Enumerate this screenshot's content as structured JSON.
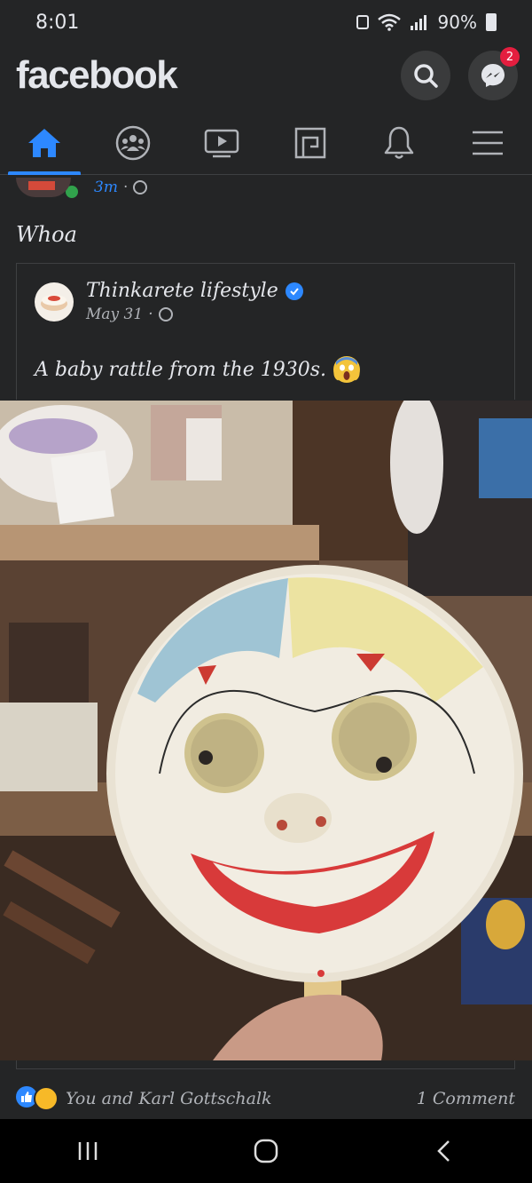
{
  "status_bar": {
    "time": "8:01",
    "battery": "90%"
  },
  "header": {
    "logo": "facebook",
    "messenger_badge": "2"
  },
  "nav": {
    "tabs": [
      "home-icon",
      "groups-icon",
      "watch-icon",
      "marketplace-icon",
      "notifications-icon",
      "menu-icon"
    ],
    "active": "home-icon"
  },
  "post": {
    "time": "3m",
    "text": "Whoa",
    "shared": {
      "page_name": "Thinkarete lifestyle",
      "date": "May 31",
      "text": "A baby rattle from the 1930s."
    }
  },
  "reactions": {
    "summary": "You and Karl Gottschalk",
    "comments": "1 Comment"
  },
  "colors": {
    "accent": "#2d88ff",
    "background": "#242526",
    "badge": "#e41e3f"
  }
}
